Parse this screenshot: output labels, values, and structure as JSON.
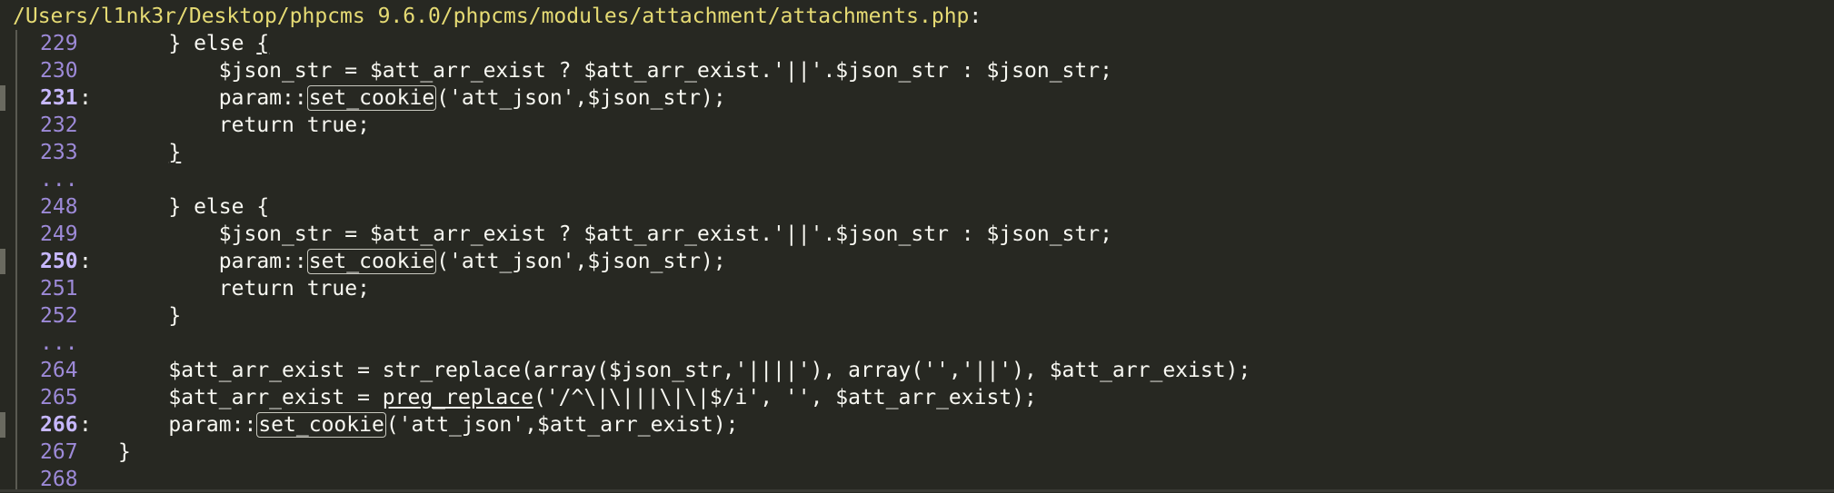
{
  "header": {
    "file_path": "/Users/l1nk3r/Desktop/phpcms 9.6.0/phpcms/modules/attachment/attachments.php",
    "path_suffix": ":"
  },
  "lines": [
    {
      "num": "229",
      "mark": "",
      "indent": "    ",
      "segments": [
        {
          "t": "} else "
        },
        {
          "t": "{",
          "style": "ul"
        }
      ]
    },
    {
      "num": "230",
      "mark": "",
      "indent": "        ",
      "segments": [
        {
          "t": "$json_str = $att_arr_exist ? $att_arr_exist.'||'.$json_str : $json_str;"
        }
      ]
    },
    {
      "num": "231",
      "mark": ":",
      "indent": "        ",
      "segments": [
        {
          "t": "param::"
        },
        {
          "t": "set_cookie",
          "style": "box"
        },
        {
          "t": "('att_json',$json_str);"
        }
      ]
    },
    {
      "num": "232",
      "mark": "",
      "indent": "        ",
      "segments": [
        {
          "t": "return true;"
        }
      ]
    },
    {
      "num": "233",
      "mark": "",
      "indent": "    ",
      "segments": [
        {
          "t": "}",
          "style": "ul"
        }
      ]
    },
    {
      "num": "...",
      "mark": "",
      "indent": "",
      "segments": []
    },
    {
      "num": "248",
      "mark": "",
      "indent": "    ",
      "segments": [
        {
          "t": "} else {"
        }
      ]
    },
    {
      "num": "249",
      "mark": "",
      "indent": "        ",
      "segments": [
        {
          "t": "$json_str = $att_arr_exist ? $att_arr_exist.'||'.$json_str : $json_str;"
        }
      ]
    },
    {
      "num": "250",
      "mark": ":",
      "indent": "        ",
      "segments": [
        {
          "t": "param::"
        },
        {
          "t": "set_cookie",
          "style": "box"
        },
        {
          "t": "('att_json',$json_str);"
        }
      ]
    },
    {
      "num": "251",
      "mark": "",
      "indent": "        ",
      "segments": [
        {
          "t": "return true;"
        }
      ]
    },
    {
      "num": "252",
      "mark": "",
      "indent": "    ",
      "segments": [
        {
          "t": "}"
        }
      ]
    },
    {
      "num": "...",
      "mark": "",
      "indent": "",
      "segments": []
    },
    {
      "num": "264",
      "mark": "",
      "indent": "    ",
      "segments": [
        {
          "t": "$att_arr_exist = str_replace(array($json_str,'||||'), array('','||'), $att_arr_exist);"
        }
      ]
    },
    {
      "num": "265",
      "mark": "",
      "indent": "    ",
      "segments": [
        {
          "t": "$att_arr_exist = "
        },
        {
          "t": "preg_replace",
          "style": "ul"
        },
        {
          "t": "('/^\\|\\|||\\|\\|$/i', '', $att_arr_exist);"
        }
      ]
    },
    {
      "num": "266",
      "mark": ":",
      "indent": "    ",
      "segments": [
        {
          "t": "param::"
        },
        {
          "t": "set_cookie",
          "style": "box"
        },
        {
          "t": "('att_json',$att_arr_exist);"
        }
      ]
    },
    {
      "num": "267",
      "mark": "",
      "indent": "",
      "segments": [
        {
          "t": "}"
        }
      ]
    },
    {
      "num": "268",
      "mark": "",
      "indent": "",
      "segments": []
    }
  ],
  "colors": {
    "background": "#272822",
    "path": "#e6db74",
    "line_number": "#9d8ad8",
    "text": "#f8f8f2"
  }
}
